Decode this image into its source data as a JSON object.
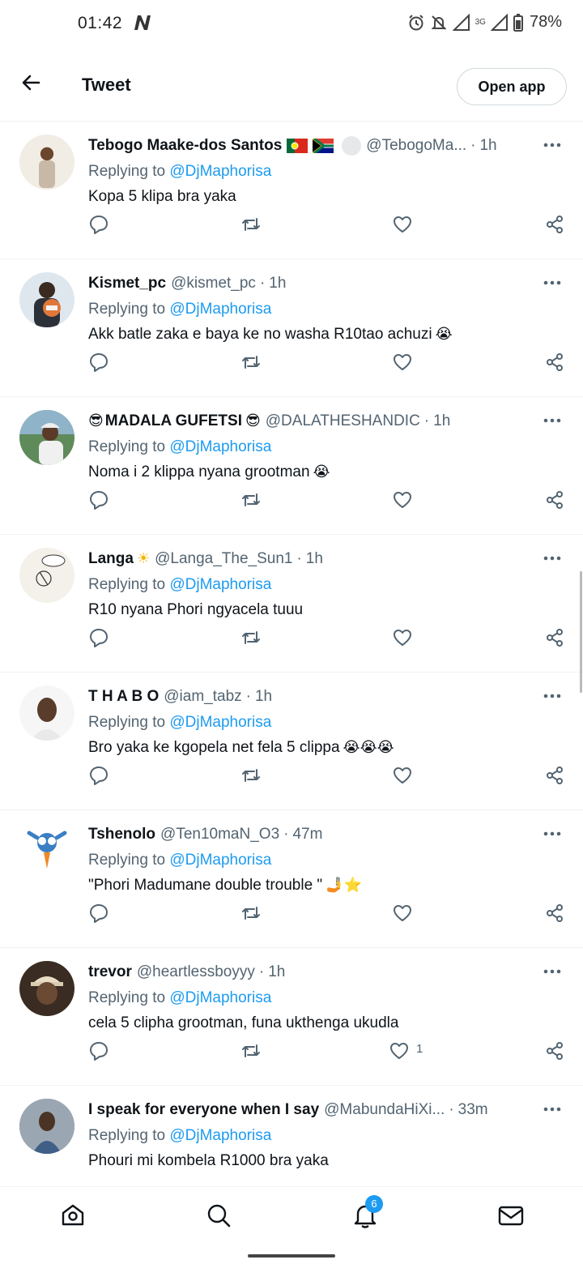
{
  "status": {
    "time": "01:42",
    "network": "3G",
    "battery": "78%"
  },
  "header": {
    "title": "Tweet",
    "open_app": "Open app"
  },
  "replying_prefix": "Replying to",
  "tweets": [
    {
      "name": "Tebogo Maake-dos Santos",
      "flags": [
        "flag-portugal-icon",
        "flag-south-africa-icon"
      ],
      "handle": "@TebogoMa...",
      "time": "1h",
      "mention": "@DjMaphorisa",
      "text": "Kopa 5 klipa bra yaka",
      "emoji": "",
      "likes": ""
    },
    {
      "name": "Kismet_pc",
      "handle": "@kismet_pc",
      "time": "1h",
      "mention": "@DjMaphorisa",
      "text": "Akk batle zaka e baya ke no washa R10tao achuzi",
      "emoji": "😭",
      "likes": ""
    },
    {
      "name": "MADALA GUFETSI",
      "name_prefix": "😎",
      "name_suffix": "😎",
      "handle": "@DALATHESHANDIC",
      "time": "1h",
      "mention": "@DjMaphorisa",
      "text": "Noma i 2 klippa nyana grootman",
      "emoji": "😭",
      "likes": ""
    },
    {
      "name": "Langa",
      "name_suffix": "☀",
      "handle": "@Langa_The_Sun1",
      "time": "1h",
      "mention": "@DjMaphorisa",
      "text": "R10 nyana Phori ngyacela tuuu",
      "emoji": "",
      "likes": ""
    },
    {
      "name": "T H A B O",
      "handle": "@iam_tabz",
      "time": "1h",
      "mention": "@DjMaphorisa",
      "text": "Bro yaka ke kgopela net fela 5 clippa",
      "emoji": "😭😭😭",
      "likes": ""
    },
    {
      "name": "Tshenolo",
      "handle": "@Ten10maN_O3",
      "time": "47m",
      "mention": "@DjMaphorisa",
      "text": "\"Phori Madumane double trouble \"",
      "emoji": "🤳⭐",
      "likes": ""
    },
    {
      "name": "trevor",
      "handle": "@heartlessboyyy",
      "time": "1h",
      "mention": "@DjMaphorisa",
      "text": "cela 5 clipha grootman, funa ukthenga ukudla",
      "emoji": "",
      "likes": "1"
    },
    {
      "name": "I speak for everyone when I say",
      "handle": "@MabundaHiXi...",
      "time": "33m",
      "mention": "@DjMaphorisa",
      "text": "Phouri mi kombela R1000 bra yaka",
      "emoji": "",
      "likes": ""
    }
  ],
  "nav": {
    "notifications_badge": "6"
  },
  "colors": {
    "accent": "#1d9bf0",
    "text": "#0f1419",
    "muted": "#536471"
  }
}
